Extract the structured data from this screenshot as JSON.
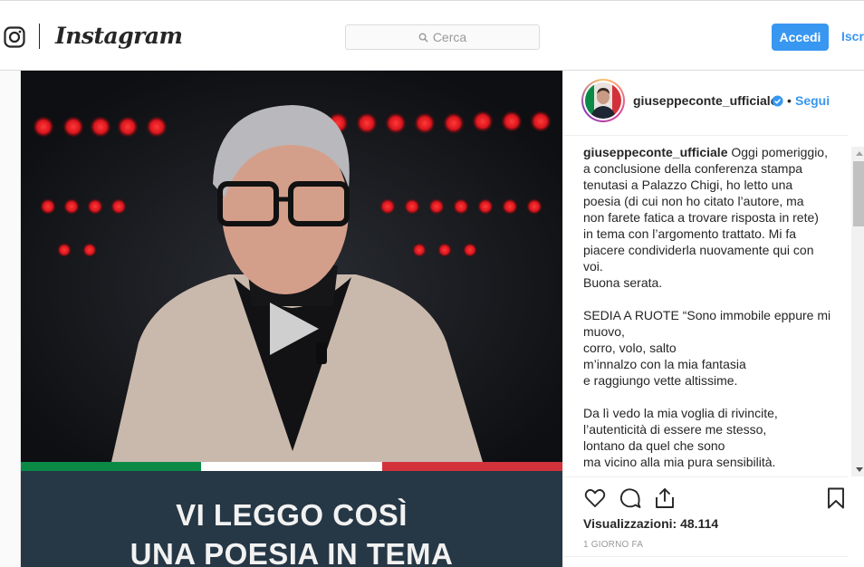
{
  "header": {
    "wordmark": "Instagram",
    "search_placeholder": "Cerca",
    "login_label": "Accedi",
    "signup_label": "Iscriviti"
  },
  "post": {
    "media": {
      "banner_line1": "VI LEGGO COSÌ",
      "banner_line2": "UNA POESIA IN TEMA",
      "flag_colors": [
        "#0b8a46",
        "#ffffff",
        "#d4323b"
      ]
    },
    "author": {
      "username": "giuseppeconte_ufficiale",
      "separator": "•",
      "follow_label": "Segui"
    },
    "caption": {
      "username": "giuseppeconte_ufficiale",
      "text": " Oggi pomeriggio,\na conclusione della conferenza stampa\ntenutasi a Palazzo Chigi, ho letto una\npoesia (di cui non ho citato l’autore, ma\nnon farete fatica a trovare risposta in rete)\nin tema con l’argomento trattato. Mi fa\npiacere condividerla nuovamente qui con\nvoi.\nBuona serata.\n\nSEDIA A RUOTE “Sono immobile eppure mi\nmuovo,\ncorro, volo, salto\nm’innalzo con la mia fantasia\ne raggiungo vette altissime.\n\nDa lì vedo la mia voglia di rivincite,\nl’autenticità di essere me stesso,\nlontano da quel che sono\nma vicino alla mia pura sensibilità."
    },
    "stats": {
      "views_label": "Visualizzazioni:",
      "views_count": "48.114"
    },
    "time_ago": "1 GIORNO FA"
  },
  "icons": {
    "logo": "instagram-glyph-icon",
    "search": "search-icon",
    "verified": "verified-badge-icon",
    "like": "heart-icon",
    "comment": "comment-icon",
    "share": "share-icon",
    "save": "bookmark-icon",
    "play": "play-icon"
  },
  "colors": {
    "accent": "#3897f0",
    "text": "#262626",
    "muted": "#999999",
    "banner": "#263745"
  }
}
